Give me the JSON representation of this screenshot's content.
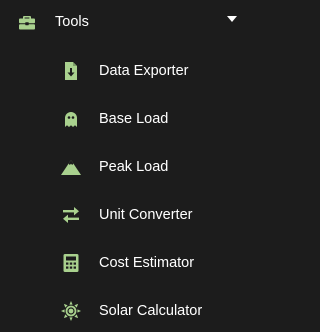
{
  "colors": {
    "background": "#1c1c1c",
    "text": "#ffffff",
    "icon_accent": "#a9d18e"
  },
  "menu": {
    "group": {
      "label": "Tools",
      "icon": "toolbox-icon",
      "expanded_indicator": "caret-down-icon"
    },
    "items": [
      {
        "label": "Data Exporter",
        "icon": "file-download-icon"
      },
      {
        "label": "Base Load",
        "icon": "ghost-icon"
      },
      {
        "label": "Peak Load",
        "icon": "mountain-icon"
      },
      {
        "label": "Unit Converter",
        "icon": "exchange-arrows-icon"
      },
      {
        "label": "Cost Estimator",
        "icon": "calculator-icon"
      },
      {
        "label": "Solar Calculator",
        "icon": "sun-icon"
      }
    ]
  }
}
